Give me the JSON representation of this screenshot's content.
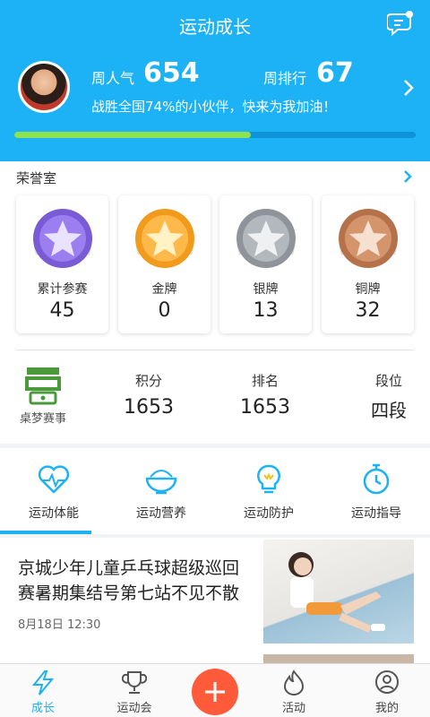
{
  "header": {
    "title": "运动成长",
    "popularity_label": "周人气",
    "popularity_value": "654",
    "rank_label": "周排行",
    "rank_value": "67",
    "beat_text": "战胜全国74%的小伙伴，快来为我加油！",
    "progress": 0.59,
    "progress_color": "#8de24f",
    "accent": "#1cb2f5"
  },
  "honor": {
    "title": "荣誉室",
    "medals": [
      {
        "label": "累计参赛",
        "value": "45",
        "color": "#7a5bd6",
        "icon": "purple-star-medal-icon"
      },
      {
        "label": "金牌",
        "value": "0",
        "color": "#f29a1c",
        "icon": "gold-star-medal-icon"
      },
      {
        "label": "银牌",
        "value": "13",
        "color": "#9aa0a6",
        "icon": "silver-star-medal-icon"
      },
      {
        "label": "铜牌",
        "value": "32",
        "color": "#c0805a",
        "icon": "bronze-star-medal-icon"
      }
    ]
  },
  "stats": {
    "logo_text": "桌梦赛事",
    "items": [
      {
        "label": "积分",
        "value": "1653"
      },
      {
        "label": "排名",
        "value": "1653"
      },
      {
        "label": "段位",
        "value": "四段"
      }
    ]
  },
  "tabs": [
    {
      "label": "运动体能",
      "icon": "heart-rate-icon"
    },
    {
      "label": "运动营养",
      "icon": "food-bowl-icon"
    },
    {
      "label": "运动防护",
      "icon": "lightbulb-icon"
    },
    {
      "label": "运动指导",
      "icon": "stopwatch-icon"
    }
  ],
  "article": {
    "title": "京城少年儿童乒乓球超级巡回赛暑期集结号第七站不见不散",
    "time": "8月18日 12:30"
  },
  "bottom_nav": [
    {
      "label": "成长",
      "icon": "lightning-icon"
    },
    {
      "label": "运动会",
      "icon": "trophy-icon"
    },
    {
      "label": "",
      "icon": "plus-icon"
    },
    {
      "label": "活动",
      "icon": "flame-icon"
    },
    {
      "label": "我的",
      "icon": "user-icon"
    }
  ]
}
